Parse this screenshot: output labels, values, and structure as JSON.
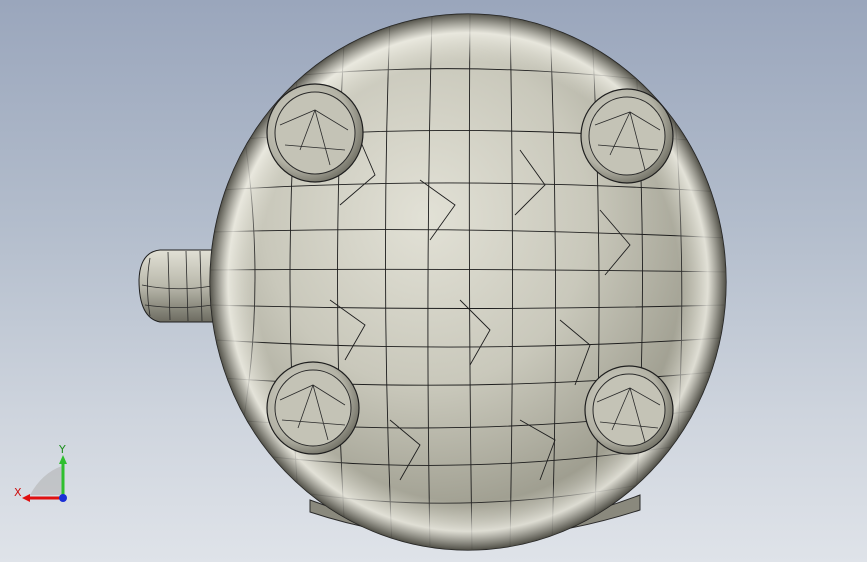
{
  "viewport": {
    "model": "mesh-part",
    "background": [
      "#9aa6bc",
      "#dfe3e9"
    ],
    "surface_color": "#b7b6a8",
    "edge_color": "#1e1e1e"
  },
  "triad": {
    "x_label": "X",
    "y_label": "Y",
    "x_color": "#e01010",
    "y_color": "#2fbf2f",
    "z_color": "#1a2fd6"
  }
}
